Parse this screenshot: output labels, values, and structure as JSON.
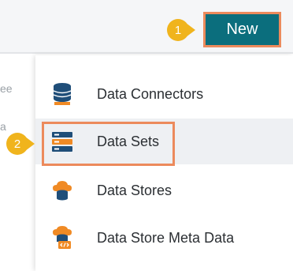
{
  "toolbar": {
    "new_button_label": "New"
  },
  "callouts": [
    {
      "number": "1"
    },
    {
      "number": "2"
    }
  ],
  "menu": {
    "items": [
      {
        "label": "Data Connectors",
        "icon": "database-icon"
      },
      {
        "label": "Data Sets",
        "icon": "server-icon",
        "active": true
      },
      {
        "label": "Data Stores",
        "icon": "cloud-database-icon"
      },
      {
        "label": "Data Store Meta Data",
        "icon": "cloud-code-icon"
      }
    ]
  },
  "colors": {
    "accent_teal": "#0b6e7d",
    "highlight_orange": "#ec8a5c",
    "callout_yellow": "#f0b41d",
    "icon_orange": "#f08a24",
    "icon_navy": "#1f4e79"
  }
}
